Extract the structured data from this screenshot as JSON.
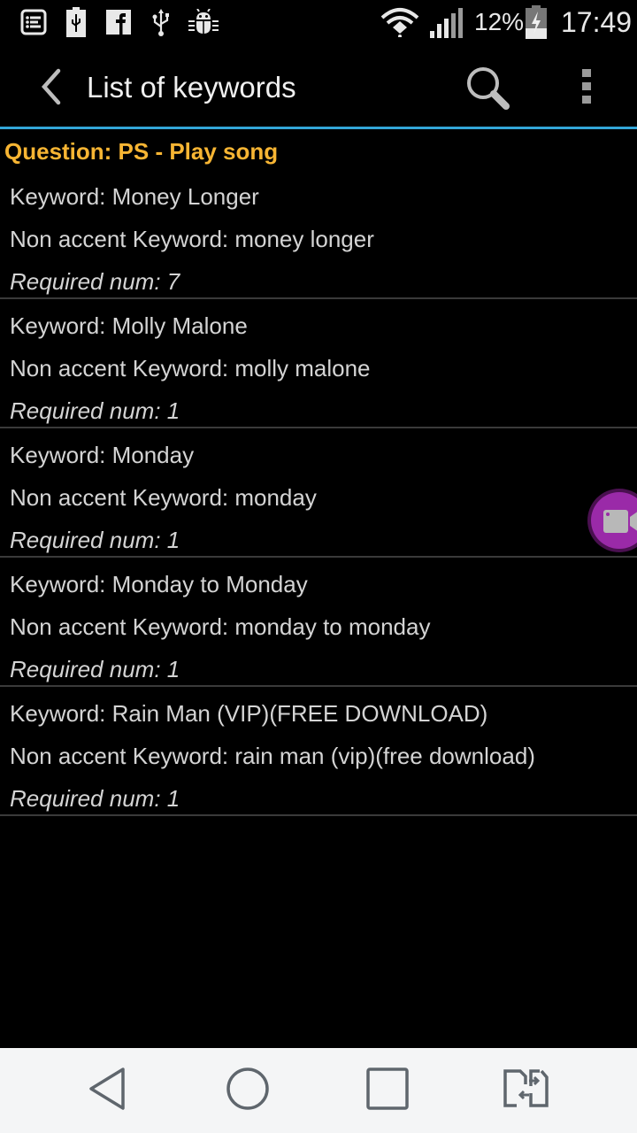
{
  "status_bar": {
    "left_icons": [
      "notes-icon",
      "usb-battery-icon",
      "facebook-icon",
      "usb-icon",
      "android-debug-icon"
    ],
    "right_icons": [
      "wifi-icon",
      "signal-icon",
      "battery-charging-icon"
    ],
    "battery_percent": "12%",
    "time": "17:49"
  },
  "action_bar": {
    "title": "List of keywords",
    "back_icon": "back-chevron-icon",
    "search_icon": "search-icon",
    "overflow_icon": "overflow-menu-icon"
  },
  "question_header": "Question: PS - Play song",
  "keywords": [
    {
      "keyword": "Keyword: Money Longer",
      "non_accent": "Non accent Keyword: money longer",
      "required": "Required num: 7"
    },
    {
      "keyword": "Keyword: Molly Malone",
      "non_accent": "Non accent Keyword: molly malone",
      "required": "Required num: 1"
    },
    {
      "keyword": "Keyword: Monday",
      "non_accent": "Non accent Keyword: monday",
      "required": "Required num: 1"
    },
    {
      "keyword": "Keyword: Monday to Monday",
      "non_accent": "Non accent Keyword: monday to monday",
      "required": "Required num: 1"
    },
    {
      "keyword": "Keyword: Rain Man (VIP)(FREE DOWNLOAD)",
      "non_accent": "Non accent Keyword: rain man (vip)(free download)",
      "required": "Required num: 1"
    }
  ],
  "floating_button": {
    "icon": "video-camera-icon",
    "color": "#9a2aa8"
  },
  "nav_bar": {
    "buttons": [
      "back-icon",
      "home-icon",
      "recents-icon",
      "switch-app-icon"
    ]
  },
  "colors": {
    "accent": "#33a6d8",
    "question": "#f7b533"
  }
}
